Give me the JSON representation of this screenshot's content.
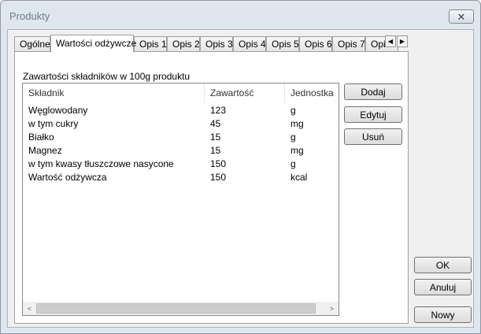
{
  "window": {
    "title": "Produkty",
    "close_glyph": "✕"
  },
  "tabs": [
    {
      "label": "Ogólne"
    },
    {
      "label": "Wartości odżywcze"
    },
    {
      "label": "Opis 1"
    },
    {
      "label": "Opis 2"
    },
    {
      "label": "Opis 3"
    },
    {
      "label": "Opis 4"
    },
    {
      "label": "Opis 5"
    },
    {
      "label": "Opis 6"
    },
    {
      "label": "Opis 7"
    },
    {
      "label": "Opis"
    }
  ],
  "tab_scroll": {
    "left": "◀",
    "right": "▶"
  },
  "nutrition": {
    "group_label": "Zawartości składników w 100g produktu",
    "columns": [
      "Składnik",
      "Zawartość",
      "Jednostka"
    ],
    "rows": [
      [
        "Węglowodany",
        "123",
        "g"
      ],
      [
        "w tym cukry",
        "45",
        "mg"
      ],
      [
        "Białko",
        "15",
        "g"
      ],
      [
        "Magnez",
        "15",
        "mg"
      ],
      [
        "w tym kwasy tłuszczowe nasycone",
        "150",
        "g"
      ],
      [
        "Wartość odżywcza",
        "150",
        "kcal"
      ]
    ],
    "scroll_left": "<",
    "scroll_right": ">"
  },
  "side_buttons": {
    "add": "Dodaj",
    "edit": "Edytuj",
    "remove": "Usuń"
  },
  "dialog_buttons": {
    "ok": "OK",
    "cancel": "Anuluj",
    "new": "Nowy"
  }
}
